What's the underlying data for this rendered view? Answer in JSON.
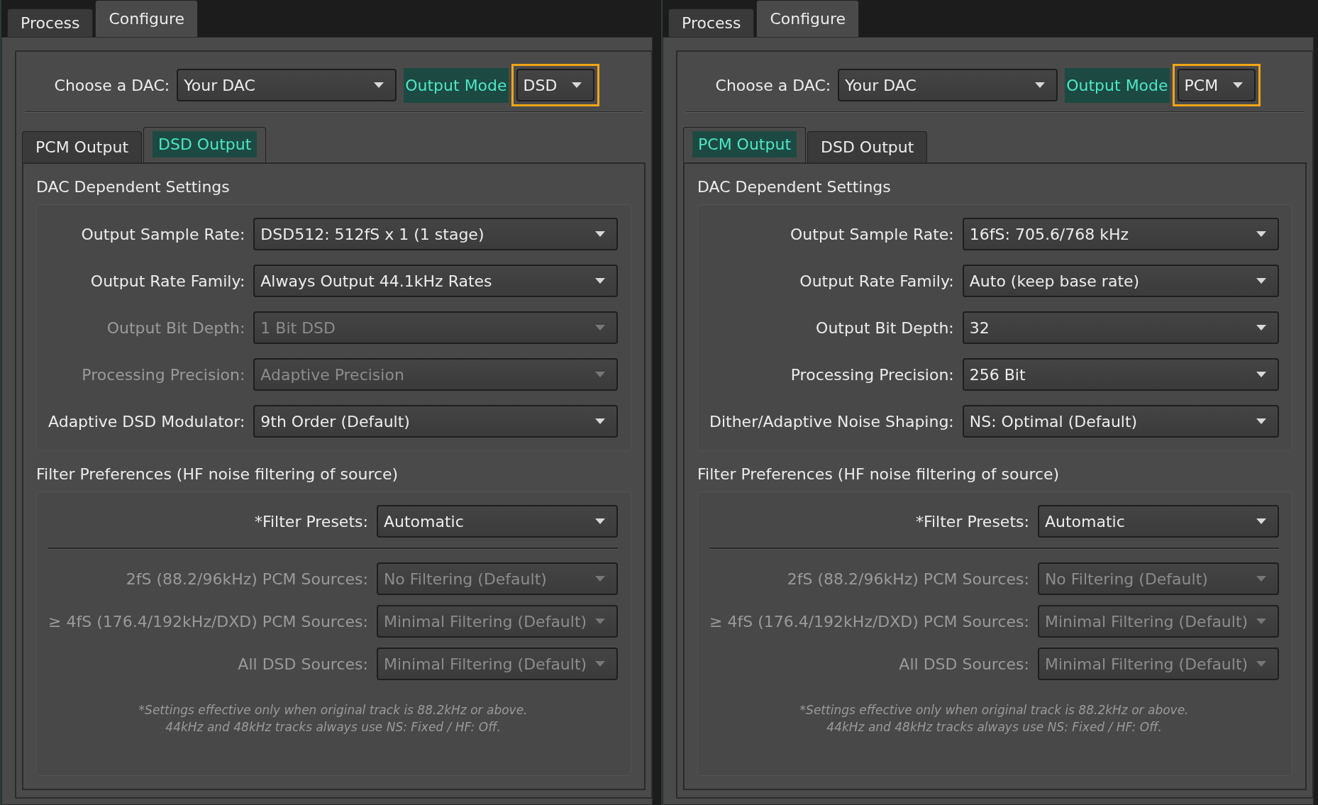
{
  "panels": [
    {
      "top_tabs": [
        {
          "label": "Process",
          "selected": false
        },
        {
          "label": "Configure",
          "selected": true
        }
      ],
      "dac": {
        "label": "Choose a DAC:",
        "value": "Your DAC"
      },
      "output_mode": {
        "label": "Output Mode",
        "value": "DSD",
        "highlighted": true
      },
      "output_tabs": [
        {
          "label": "PCM Output",
          "selected": false
        },
        {
          "label": "DSD Output",
          "selected": true
        }
      ],
      "dac_settings": {
        "title": "DAC Dependent Settings",
        "rows": [
          {
            "label": "Output Sample Rate:",
            "value": "DSD512: 512fS x 1 (1 stage)",
            "disabled": false
          },
          {
            "label": "Output Rate Family:",
            "value": "Always Output 44.1kHz Rates",
            "disabled": false
          },
          {
            "label": "Output Bit Depth:",
            "value": "1 Bit DSD",
            "disabled": true
          },
          {
            "label": "Processing Precision:",
            "value": "Adaptive Precision",
            "disabled": true
          },
          {
            "label": "Adaptive DSD Modulator:",
            "value": "9th Order (Default)",
            "disabled": false
          }
        ]
      },
      "filter": {
        "title": "Filter Preferences (HF noise filtering of source)",
        "preset": {
          "label": "*Filter Presets:",
          "value": "Automatic"
        },
        "rows": [
          {
            "label": "2fS (88.2/96kHz) PCM Sources:",
            "value": "No Filtering (Default)",
            "disabled": true
          },
          {
            "label": "≥ 4fS (176.4/192kHz/DXD) PCM Sources:",
            "value": "Minimal Filtering (Default)",
            "disabled": true
          },
          {
            "label": "All DSD Sources:",
            "value": "Minimal Filtering (Default)",
            "disabled": true
          }
        ],
        "footnote": [
          "*Settings effective only when original track is 88.2kHz or above.",
          "44kHz and 48kHz tracks always use NS: Fixed / HF: Off."
        ]
      }
    },
    {
      "top_tabs": [
        {
          "label": "Process",
          "selected": false
        },
        {
          "label": "Configure",
          "selected": true
        }
      ],
      "dac": {
        "label": "Choose a DAC:",
        "value": "Your DAC"
      },
      "output_mode": {
        "label": "Output Mode",
        "value": "PCM",
        "highlighted": true
      },
      "output_tabs": [
        {
          "label": "PCM Output",
          "selected": true
        },
        {
          "label": "DSD Output",
          "selected": false
        }
      ],
      "dac_settings": {
        "title": "DAC Dependent Settings",
        "rows": [
          {
            "label": "Output Sample Rate:",
            "value": "16fS: 705.6/768 kHz",
            "disabled": false
          },
          {
            "label": "Output Rate Family:",
            "value": "Auto (keep base rate)",
            "disabled": false
          },
          {
            "label": "Output Bit Depth:",
            "value": "32",
            "disabled": false
          },
          {
            "label": "Processing Precision:",
            "value": "256 Bit",
            "disabled": false
          },
          {
            "label": "Dither/Adaptive Noise Shaping:",
            "value": "NS: Optimal (Default)",
            "disabled": false
          }
        ]
      },
      "filter": {
        "title": "Filter Preferences (HF noise filtering of source)",
        "preset": {
          "label": "*Filter Presets:",
          "value": "Automatic"
        },
        "rows": [
          {
            "label": "2fS (88.2/96kHz) PCM Sources:",
            "value": "No Filtering (Default)",
            "disabled": true
          },
          {
            "label": "≥ 4fS (176.4/192kHz/DXD) PCM Sources:",
            "value": "Minimal Filtering (Default)",
            "disabled": true
          },
          {
            "label": "All DSD Sources:",
            "value": "Minimal Filtering (Default)",
            "disabled": true
          }
        ],
        "footnote": [
          "*Settings effective only when original track is 88.2kHz or above.",
          "44kHz and 48kHz tracks always use NS: Fixed / HF: Off."
        ]
      }
    }
  ]
}
